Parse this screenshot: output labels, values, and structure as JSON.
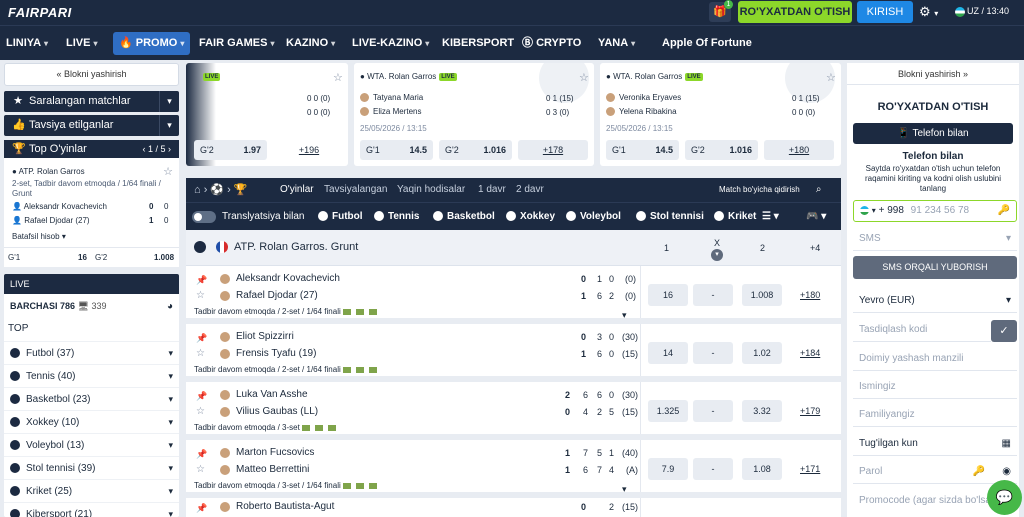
{
  "brand": {
    "logo": "FAIRPARI",
    "accent": "#8cd72a",
    "dark": "#1c2a41",
    "blue": "#1e88e5"
  },
  "header": {
    "gift_count": "1",
    "register": "RO'YXATDAN O'TISH",
    "login": "KIRISH",
    "lang": "UZ",
    "time": "13:40"
  },
  "nav": [
    "LINIYA",
    "LIVE",
    "PROMO",
    "FAIR GAMES",
    "KAZINO",
    "LIVE-KAZINO",
    "KIBERSPORT",
    "CRYPTO",
    "YANA",
    "Apple Of Fortune"
  ],
  "left": {
    "hide": "« Blokni yashirish",
    "saved": "Saralangan matchlar",
    "recommended": "Tavsiya etilganlar",
    "top": {
      "title": "Top O'yinlar",
      "pager": "1 / 5",
      "tour": "ATP. Rolan Garros",
      "status": "2-set, Tadbir davom etmoqda / 1/64 finali / Grunt",
      "p1": "Aleksandr Kovachevich",
      "p1score": "0",
      "p1set": "0",
      "p2": "Rafael Djodar (27)",
      "p2score": "1",
      "p2set": "0",
      "detail": "Batafsil hisob",
      "g1": "G'1",
      "g1v": "16",
      "g2": "G'2",
      "g2v": "1.008"
    },
    "live": {
      "title": "LIVE",
      "all": "BARCHASI 786",
      "count": "339",
      "top": "TOP",
      "sports": [
        {
          "name": "Futbol (37)"
        },
        {
          "name": "Tennis (40)"
        },
        {
          "name": "Basketbol (23)"
        },
        {
          "name": "Xokkey (10)"
        },
        {
          "name": "Voleybol (13)"
        },
        {
          "name": "Stol tennisi (39)"
        },
        {
          "name": "Kriket (25)"
        },
        {
          "name": "Kibersport (21)"
        }
      ]
    }
  },
  "cards": [
    {
      "live": "LIVE",
      "s1": "0 0 (0)",
      "s2": "0 0 (0)",
      "g": "G'2",
      "gv": "1.97",
      "more": "+196"
    },
    {
      "tour": "WTA. Rolan Garros",
      "live": "LIVE",
      "p1": "Tatyana Maria",
      "p2": "Eliza Mertens",
      "s1": "0 1 (15)",
      "s2": "0 3 (0)",
      "date": "25/05/2026 / 13:15",
      "g1": "G'1",
      "g1v": "14.5",
      "g2": "G'2",
      "g2v": "1.016",
      "more": "+178"
    },
    {
      "tour": "WTA. Rolan Garros",
      "live": "LIVE",
      "p1": "Veronika Eryaves",
      "p2": "Yelena Ribakina",
      "s1": "0 1 (15)",
      "s2": "0 0 (0)",
      "date": "25/05/2026 / 13:15",
      "g1": "G'1",
      "g1v": "14.5",
      "g2": "G'2",
      "g2v": "1.016",
      "more": "+180"
    }
  ],
  "center": {
    "tabs": [
      "O'yinlar",
      "Tavsiyalangan",
      "Yaqin hodisalar",
      "1 davr",
      "2 davr"
    ],
    "search": "Match bo'yicha qidirish",
    "broadcast": "Translyatsiya bilan",
    "sports": [
      "Futbol",
      "Tennis",
      "Basketbol",
      "Xokkey",
      "Voleybol",
      "Stol tennisi",
      "Kriket"
    ],
    "tournament": "ATP. Rolan Garros. Grunt",
    "cols": [
      "1",
      "X",
      "2",
      "+4"
    ],
    "events": [
      {
        "p1": "Aleksandr Kovachevich",
        "p2": "Rafael Djodar (27)",
        "a": [
          "0",
          "1",
          "0",
          "(0)"
        ],
        "b": [
          "1",
          "6",
          "2",
          "(0)"
        ],
        "info": "Tadbir davom etmoqda / 2-set / 1/64 finali",
        "o1": "16",
        "ox": "-",
        "o2": "1.008",
        "more": "+180"
      },
      {
        "p1": "Eliot Spizzirri",
        "p2": "Frensis Tyafu (19)",
        "a": [
          "0",
          "3",
          "0",
          "(30)"
        ],
        "b": [
          "1",
          "6",
          "0",
          "(15)"
        ],
        "info": "Tadbir davom etmoqda / 2-set / 1/64 finali",
        "o1": "14",
        "ox": "-",
        "o2": "1.02",
        "more": "+184"
      },
      {
        "p1": "Luka Van Asshe",
        "p2": "Vilius Gaubas (LL)",
        "a": [
          "2",
          "6",
          "6",
          "0",
          "(30)"
        ],
        "b": [
          "0",
          "4",
          "2",
          "5",
          "(15)"
        ],
        "info": "Tadbir davom etmoqda / 3-set",
        "o1": "1.325",
        "ox": "-",
        "o2": "3.32",
        "more": "+179"
      },
      {
        "p1": "Marton Fucsovics",
        "p2": "Matteo Berrettini",
        "a": [
          "1",
          "7",
          "5",
          "1",
          "(40)"
        ],
        "b": [
          "1",
          "6",
          "7",
          "4",
          "(A)"
        ],
        "info": "Tadbir davom etmoqda / 3-set / 1/64 finali",
        "o1": "7.9",
        "ox": "-",
        "o2": "1.08",
        "more": "+171"
      },
      {
        "p1": "Roberto Bautista-Agut",
        "p2": "",
        "a": [
          "0",
          "2",
          "(15)"
        ],
        "b": [],
        "info": "",
        "o1": "",
        "ox": "",
        "o2": "",
        "more": ""
      }
    ]
  },
  "right": {
    "hide": "Blokni yashirish »",
    "title": "RO'YXATDAN O'TISH",
    "phone_btn": "Telefon bilan",
    "sub": "Telefon bilan",
    "desc": "Saytda ro'yxatdan o'tish uchun telefon raqamini kiriting va kodni olish uslubini tanlang",
    "code": "+ 998",
    "phone_ph": "91 234 56 78",
    "sms": "SMS",
    "sms_btn": "SMS ORQALI YUBORISH",
    "currency": "Yevro (EUR)",
    "confirm": "Tasdiqlash kodi",
    "address": "Doimiy yashash manzili",
    "name": "Ismingiz",
    "surname": "Familiyangiz",
    "birthday": "Tug'ilgan kun",
    "password": "Parol",
    "promo": "Promocode (agar sizda bo'lsa)"
  }
}
